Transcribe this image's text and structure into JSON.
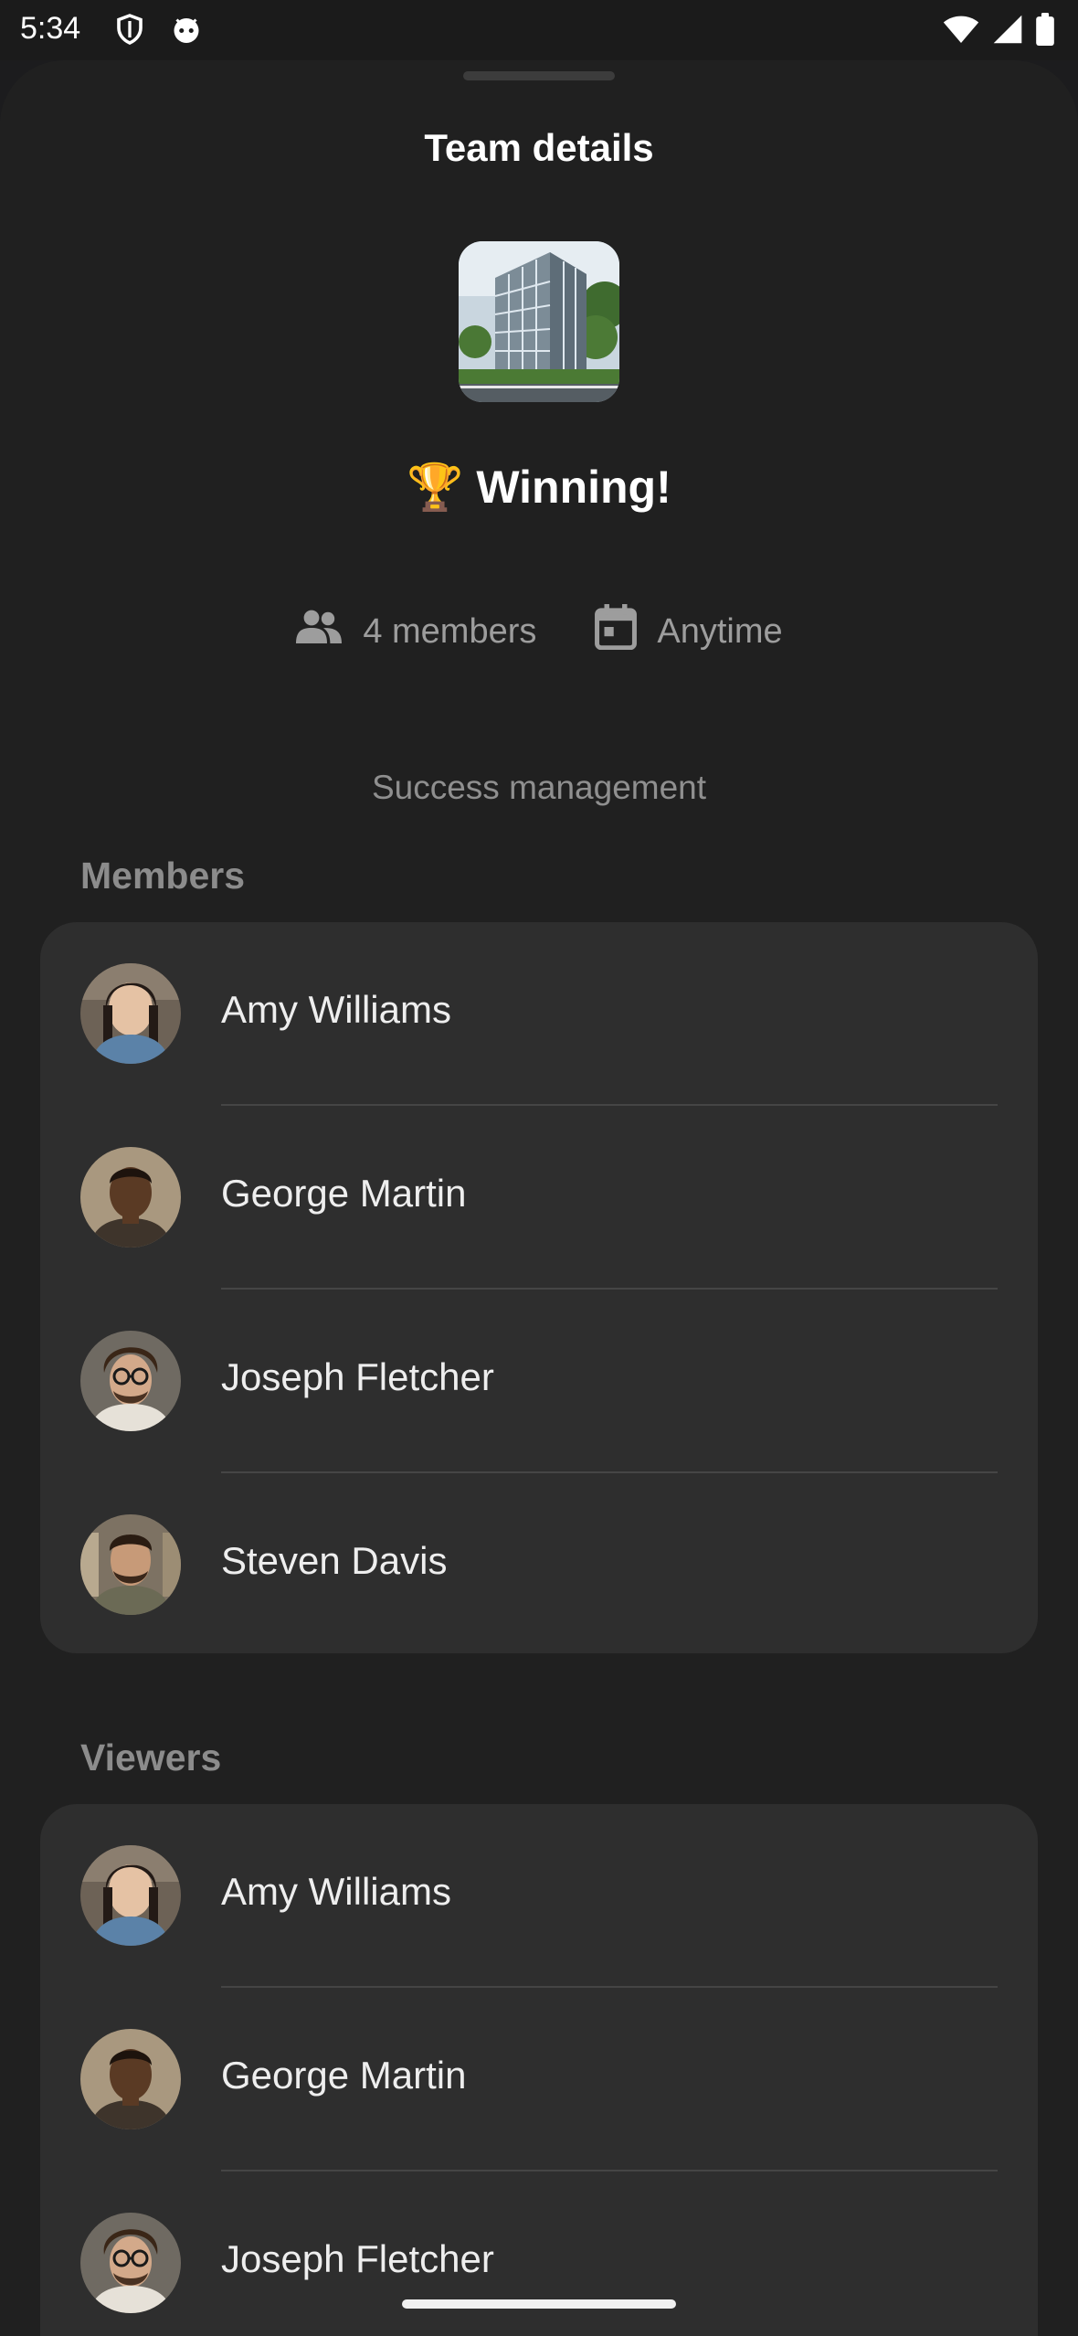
{
  "status_bar": {
    "time": "5:34",
    "icons": [
      "shield-icon",
      "android-face-icon",
      "wifi-icon",
      "cell-signal-icon",
      "battery-icon"
    ]
  },
  "sheet": {
    "title": "Team details",
    "team_image": "office-building-image",
    "team_name": "🏆 Winning!",
    "members_count": "4 members",
    "schedule": "Anytime",
    "description": "Success management"
  },
  "members": {
    "title": "Members",
    "items": [
      {
        "name": "Amy Williams"
      },
      {
        "name": "George Martin"
      },
      {
        "name": "Joseph Fletcher"
      },
      {
        "name": "Steven Davis"
      }
    ]
  },
  "viewers": {
    "title": "Viewers",
    "items": [
      {
        "name": "Amy Williams"
      },
      {
        "name": "George Martin"
      },
      {
        "name": "Joseph Fletcher"
      }
    ]
  },
  "colors": {
    "background": "#1c1c1e",
    "sheet": "#202020",
    "card": "#2e2e2e",
    "muted_text": "#9d9d9d"
  }
}
